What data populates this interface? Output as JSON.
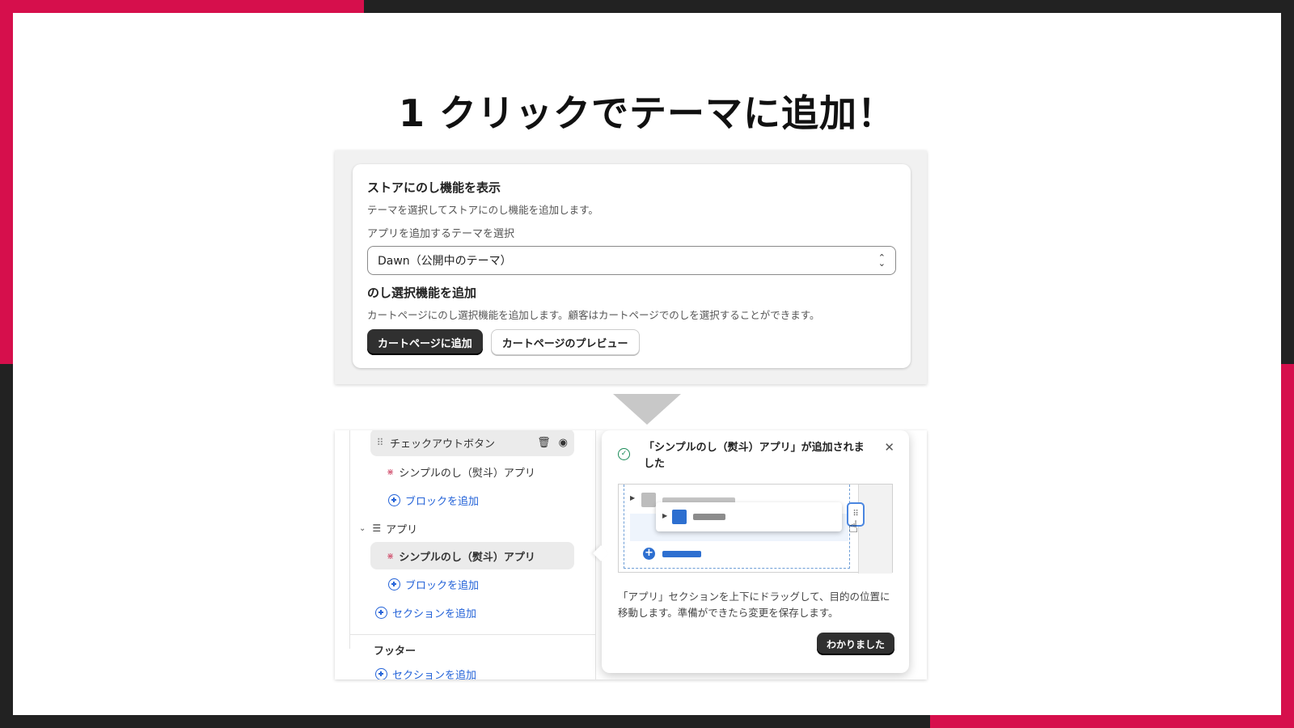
{
  "slide": {
    "title": "1 クリックでテーマに追加！"
  },
  "settings_card": {
    "heading": "ストアにのし機能を表示",
    "description": "テーマを選択してストアにのし機能を追加します。",
    "theme_select_label": "アプリを追加するテーマを選択",
    "theme_select_value": "Dawn（公開中のテーマ）",
    "section_heading": "のし選択機能を追加",
    "section_description": "カートページにのし選択機能を追加します。顧客はカートページでのしを選択することができます。",
    "primary_button": "カートページに追加",
    "secondary_button": "カートページのプレビュー"
  },
  "editor_sidebar": {
    "items": [
      {
        "label": "チェックアウトボタン"
      },
      {
        "label": "シンプルのし（熨斗）アプリ"
      },
      {
        "label": "ブロックを追加"
      },
      {
        "label": "アプリ"
      },
      {
        "label": "シンプルのし（熨斗）アプリ"
      },
      {
        "label": "ブロックを追加"
      },
      {
        "label": "セクションを追加"
      }
    ],
    "footer_heading": "フッター",
    "footer_add_section": "セクションを追加"
  },
  "popover": {
    "title": "「シンプルのし（熨斗）アプリ」が追加されました",
    "description": "「アプリ」セクションを上下にドラッグして、目的の位置に移動します。準備ができたら変更を保存します。",
    "button": "わかりました"
  },
  "colors": {
    "accent": "#d60f4c",
    "dark": "#222222",
    "primary_button": "#303030",
    "link_blue": "#2463d8"
  }
}
